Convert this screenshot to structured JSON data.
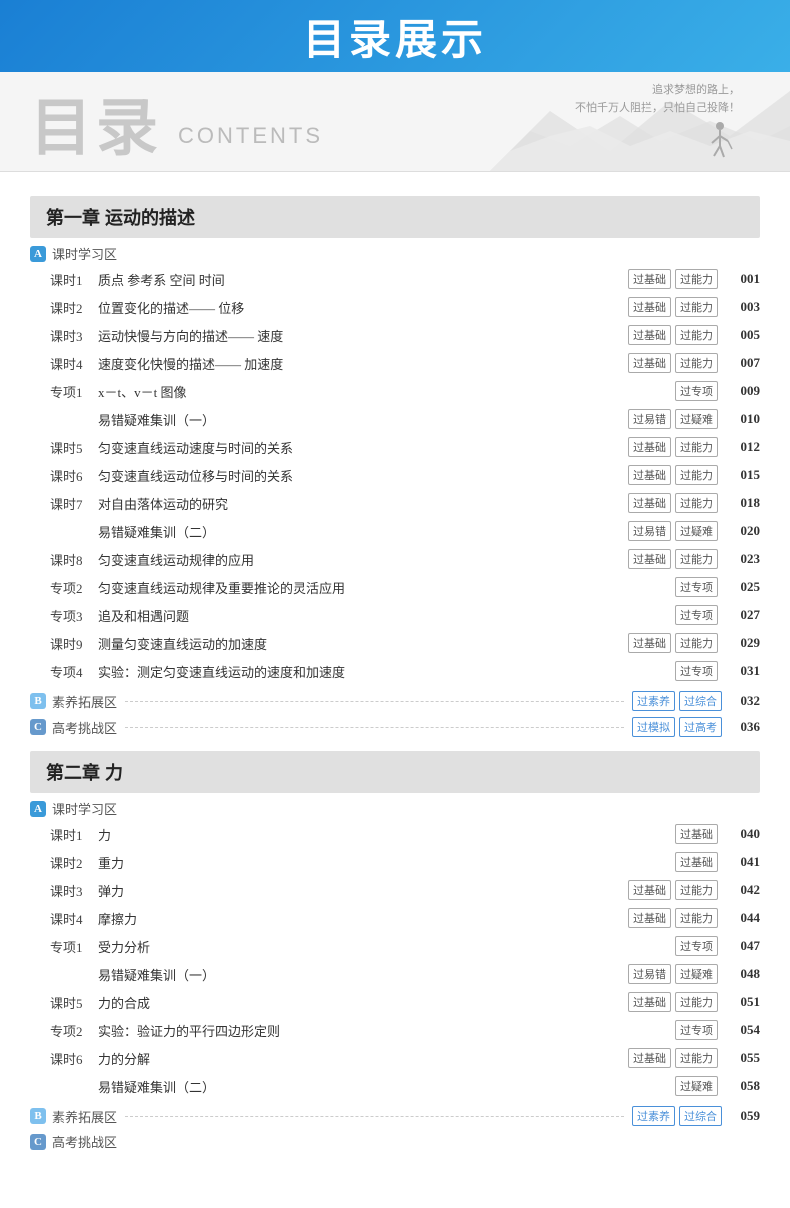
{
  "header": {
    "banner_title": "目录展示",
    "zh_title": "目录",
    "en_title": "CONTENTS",
    "motto_line1": "追求梦想的路上，",
    "motto_line2": "不怕千万人阻拦，只怕自己投降！"
  },
  "chapters": [
    {
      "id": "ch1",
      "title": "第一章   运动的描述",
      "sections": [
        {
          "type": "section-label",
          "badge": "A",
          "badge_class": "badge-a",
          "name": "课时学习区"
        },
        {
          "type": "row",
          "num": "课时1",
          "text": "质点  参考系  空间  时间",
          "tags": [
            "过基础",
            "过能力"
          ],
          "page": "001"
        },
        {
          "type": "row",
          "num": "课时2",
          "text": "位置变化的描述—— 位移",
          "tags": [
            "过基础",
            "过能力"
          ],
          "page": "003"
        },
        {
          "type": "row",
          "num": "课时3",
          "text": "运动快慢与方向的描述—— 速度",
          "tags": [
            "过基础",
            "过能力"
          ],
          "page": "005"
        },
        {
          "type": "row",
          "num": "课时4",
          "text": "速度变化快慢的描述—— 加速度",
          "tags": [
            "过基础",
            "过能力"
          ],
          "page": "007"
        },
        {
          "type": "row",
          "num": "专项1",
          "text": "x－t、v－t 图像",
          "tags": [
            "过专项"
          ],
          "page": "009"
        },
        {
          "type": "row",
          "num": "",
          "text": "易错疑难集训（一）",
          "tags": [
            "过易错",
            "过疑难"
          ],
          "page": "010"
        },
        {
          "type": "row",
          "num": "课时5",
          "text": "匀变速直线运动速度与时间的关系",
          "tags": [
            "过基础",
            "过能力"
          ],
          "page": "012"
        },
        {
          "type": "row",
          "num": "课时6",
          "text": "匀变速直线运动位移与时间的关系",
          "tags": [
            "过基础",
            "过能力"
          ],
          "page": "015"
        },
        {
          "type": "row",
          "num": "课时7",
          "text": "对自由落体运动的研究",
          "tags": [
            "过基础",
            "过能力"
          ],
          "page": "018"
        },
        {
          "type": "row",
          "num": "",
          "text": "易错疑难集训（二）",
          "tags": [
            "过易错",
            "过疑难"
          ],
          "page": "020"
        },
        {
          "type": "row",
          "num": "课时8",
          "text": "匀变速直线运动规律的应用",
          "tags": [
            "过基础",
            "过能力"
          ],
          "page": "023"
        },
        {
          "type": "row",
          "num": "专项2",
          "text": "匀变速直线运动规律及重要推论的灵活应用",
          "tags": [
            "过专项"
          ],
          "page": "025"
        },
        {
          "type": "row",
          "num": "专项3",
          "text": "追及和相遇问题",
          "tags": [
            "过专项"
          ],
          "page": "027"
        },
        {
          "type": "row",
          "num": "课时9",
          "text": "测量匀变速直线运动的加速度",
          "tags": [
            "过基础",
            "过能力"
          ],
          "page": "029"
        },
        {
          "type": "row",
          "num": "专项4",
          "text": "实验：测定匀变速直线运动的速度和加速度",
          "tags": [
            "过专项"
          ],
          "page": "031"
        },
        {
          "type": "section-label",
          "badge": "B",
          "badge_class": "badge-b",
          "name": "素养拓展区",
          "tags": [
            "过素养",
            "过综合"
          ],
          "page": "032"
        },
        {
          "type": "section-label",
          "badge": "C",
          "badge_class": "badge-c",
          "name": "高考挑战区",
          "tags": [
            "过模拟",
            "过高考"
          ],
          "page": "036"
        }
      ]
    },
    {
      "id": "ch2",
      "title": "第二章   力",
      "sections": [
        {
          "type": "section-label",
          "badge": "A",
          "badge_class": "badge-a",
          "name": "课时学习区"
        },
        {
          "type": "row",
          "num": "课时1",
          "text": "力",
          "tags": [
            "过基础"
          ],
          "page": "040"
        },
        {
          "type": "row",
          "num": "课时2",
          "text": "重力",
          "tags": [
            "过基础"
          ],
          "page": "041"
        },
        {
          "type": "row",
          "num": "课时3",
          "text": "弹力",
          "tags": [
            "过基础",
            "过能力"
          ],
          "page": "042"
        },
        {
          "type": "row",
          "num": "课时4",
          "text": "摩擦力",
          "tags": [
            "过基础",
            "过能力"
          ],
          "page": "044"
        },
        {
          "type": "row",
          "num": "专项1",
          "text": "受力分析",
          "tags": [
            "过专项"
          ],
          "page": "047"
        },
        {
          "type": "row",
          "num": "",
          "text": "易错疑难集训（一）",
          "tags": [
            "过易错",
            "过疑难"
          ],
          "page": "048"
        },
        {
          "type": "row",
          "num": "课时5",
          "text": "力的合成",
          "tags": [
            "过基础",
            "过能力"
          ],
          "page": "051"
        },
        {
          "type": "row",
          "num": "专项2",
          "text": "实验：验证力的平行四边形定则",
          "tags": [
            "过专项"
          ],
          "page": "054"
        },
        {
          "type": "row",
          "num": "课时6",
          "text": "力的分解",
          "tags": [
            "过基础",
            "过能力"
          ],
          "page": "055"
        },
        {
          "type": "row",
          "num": "",
          "text": "易错疑难集训（二）",
          "tags": [
            "过疑难"
          ],
          "page": "058"
        },
        {
          "type": "section-label",
          "badge": "B",
          "badge_class": "badge-b",
          "name": "素养拓展区",
          "tags": [
            "过素养",
            "过综合"
          ],
          "page": "059"
        },
        {
          "type": "section-label",
          "badge": "C",
          "badge_class": "badge-c",
          "name": "高考挑战区",
          "tags": [],
          "page": "..."
        }
      ]
    }
  ]
}
